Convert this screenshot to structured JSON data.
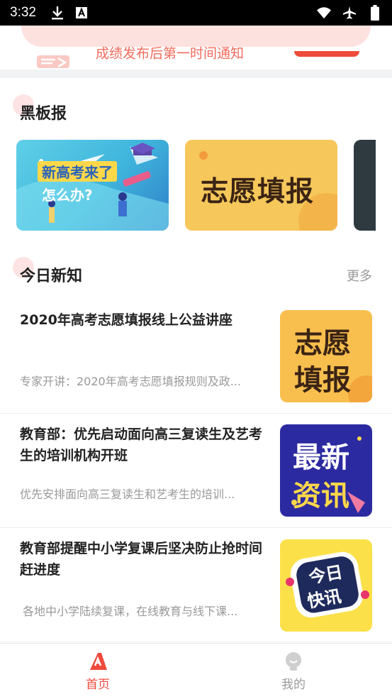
{
  "status_bar": {
    "time": "3:32",
    "left_icons": [
      "download-icon",
      "text-a-icon"
    ],
    "right_icons": [
      "wifi-icon",
      "airplane-icon",
      "battery-icon"
    ]
  },
  "banner": {
    "text": "成绩发布后第一时间通知"
  },
  "blackboard": {
    "title": "黑板报",
    "cards": [
      {
        "line1": "新高考来了",
        "line2": "怎么办?"
      },
      {
        "label": "志愿填报"
      },
      {
        "label": ""
      }
    ]
  },
  "today_news": {
    "title": "今日新知",
    "more": "更多",
    "items": [
      {
        "title": "2020年高考志愿填报线上公益讲座",
        "desc": "专家开讲：2020年高考志愿填报规则及政...",
        "thumb_line1": "志愿",
        "thumb_line2": "填报"
      },
      {
        "title": "教育部：优先启动面向高三复读生及艺考生的培训机构开班",
        "desc": "优先安排面向高三复读生和艺考生的培训...",
        "thumb_line1": "最新",
        "thumb_line2": "资讯"
      },
      {
        "title": "教育部提醒中小学复课后坚决防止抢时间赶进度",
        "desc": "各地中小学陆续复课，在线教育与线下课...",
        "thumb_line1": "今日",
        "thumb_line2": "快讯"
      }
    ]
  },
  "tab_bar": {
    "home_label": "首页",
    "mine_label": "我的"
  },
  "colors": {
    "accent": "#ee4b3c",
    "muted": "#999999"
  }
}
